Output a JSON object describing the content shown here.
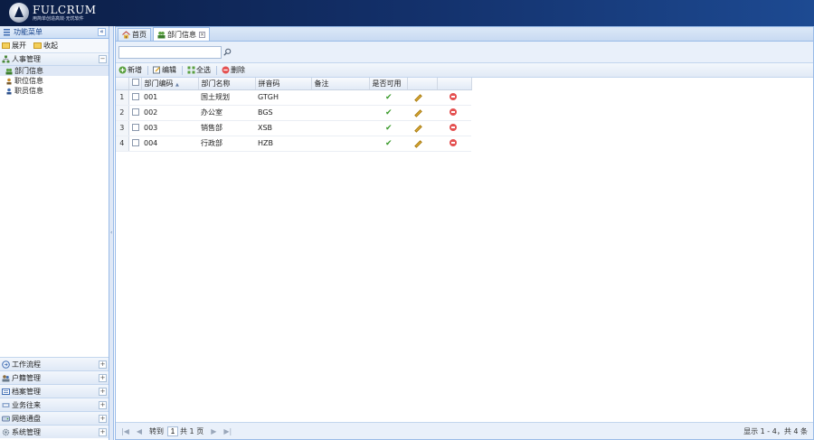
{
  "brand": {
    "name": "FULCRUM",
    "tagline": "用简单创造高效·无忧软件"
  },
  "sidebar": {
    "title": "功能菜单",
    "collapse": "«",
    "tools": [
      {
        "label": "展开"
      },
      {
        "label": "收起"
      }
    ],
    "group_open": {
      "label": "人事管理",
      "toggle": "−"
    },
    "tree": [
      {
        "label": "部门信息",
        "selected": true
      },
      {
        "label": "职位信息"
      },
      {
        "label": "职员信息"
      }
    ],
    "groups": [
      {
        "label": "工作流程"
      },
      {
        "label": "户籍管理"
      },
      {
        "label": "档案管理"
      },
      {
        "label": "业务往来"
      },
      {
        "label": "网络通盘"
      },
      {
        "label": "系统管理"
      }
    ],
    "group_toggle": "+"
  },
  "tabs": [
    {
      "label": "首页"
    },
    {
      "label": "部门信息",
      "close": "×"
    }
  ],
  "search": {
    "placeholder": "",
    "value": ""
  },
  "toolbar": {
    "add": "新增",
    "edit": "编辑",
    "select_all": "全选",
    "delete": "删除"
  },
  "grid": {
    "columns": [
      "部门编码",
      "部门名称",
      "拼音码",
      "备注",
      "是否可用",
      "",
      ""
    ],
    "sort_indicator": "▲",
    "rows": [
      {
        "n": "1",
        "code": "001",
        "name": "国土规划",
        "py": "GTGH",
        "note": "",
        "enabled": "✔"
      },
      {
        "n": "2",
        "code": "002",
        "name": "办公室",
        "py": "BGS",
        "note": "",
        "enabled": "✔"
      },
      {
        "n": "3",
        "code": "003",
        "name": "销售部",
        "py": "XSB",
        "note": "",
        "enabled": "✔"
      },
      {
        "n": "4",
        "code": "004",
        "name": "行政部",
        "py": "HZB",
        "note": "",
        "enabled": "✔"
      }
    ]
  },
  "pager": {
    "first": "|◀",
    "prev": "◀",
    "goto": "转到",
    "page": "1",
    "total": "共 1 页",
    "next": "▶",
    "last": "▶|",
    "info": "显示 1 - 4，共 4 条"
  }
}
